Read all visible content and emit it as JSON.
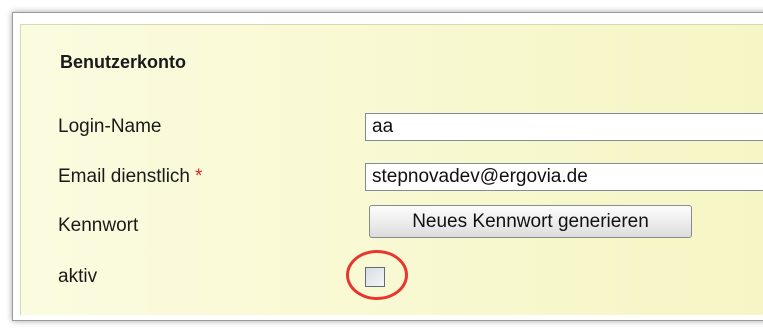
{
  "section": {
    "title": "Benutzerkonto"
  },
  "fields": {
    "login_label": "Login-Name",
    "login_value": "aa",
    "email_label": "Email dienstlich",
    "email_required_marker": "*",
    "email_value": "stepnovadev@ergovia.de",
    "password_label": "Kennwort",
    "generate_button_label": "Neues Kennwort generieren",
    "active_label": "aktiv",
    "active_checked": false
  },
  "colors": {
    "panel_background": "#f8f8cf",
    "required_marker": "#e0242b",
    "highlight_circle": "#e8372e"
  }
}
